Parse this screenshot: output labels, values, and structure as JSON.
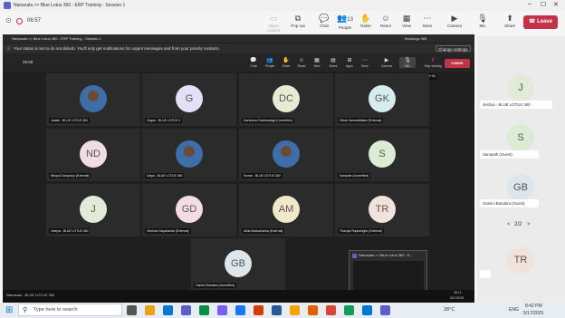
{
  "outer": {
    "title": "Nanasala >> Blue Lotus 360 - ERP Training - Session 1",
    "timer": "06:57",
    "toolbar": [
      {
        "label": "Open context",
        "icon": "context-icon"
      },
      {
        "label": "Pop out",
        "icon": "popout-icon"
      },
      {
        "label": "Chat",
        "icon": "chat-icon"
      },
      {
        "label": "People",
        "icon": "people-icon",
        "count": "13"
      },
      {
        "label": "Raise",
        "icon": "raise-hand-icon"
      },
      {
        "label": "React",
        "icon": "react-icon"
      },
      {
        "label": "View",
        "icon": "view-icon"
      },
      {
        "label": "More",
        "icon": "more-icon"
      },
      {
        "label": "Camera",
        "icon": "camera-icon"
      },
      {
        "label": "Mic",
        "icon": "mic-icon"
      },
      {
        "label": "Share",
        "icon": "share-icon"
      }
    ],
    "leave_label": "Leave"
  },
  "side_panel": {
    "participants": [
      {
        "initials": "J",
        "name": "Jeshya - BLUE LOTUS 360"
      },
      {
        "initials": "S",
        "name": "Sampath (Guest)"
      },
      {
        "initials": "GB",
        "name": "Gamini Bandara (Guest)"
      },
      {
        "initials": "TR",
        "name": ""
      }
    ],
    "pager": "2/2"
  },
  "inner": {
    "title": "Nanasala >> Blue Lotus 360 - ERP Training - Session 1",
    "bookings": "Bookings 365",
    "notice": "Your status is set to do not disturb. You'll only get notifications for urgent messages and from your priority contacts.",
    "change_settings": "Change settings",
    "timer": "39:59",
    "toolbar": [
      {
        "label": "Chat",
        "icon": "chat-icon"
      },
      {
        "label": "People",
        "icon": "people-icon",
        "count": "13"
      },
      {
        "label": "Raise",
        "icon": "raise-hand-icon"
      },
      {
        "label": "React",
        "icon": "react-icon"
      },
      {
        "label": "View",
        "icon": "view-icon"
      },
      {
        "label": "Notes",
        "icon": "notes-icon"
      },
      {
        "label": "Apps",
        "icon": "apps-icon"
      },
      {
        "label": "More",
        "icon": "more-icon"
      },
      {
        "label": "Camera",
        "icon": "camera-icon"
      },
      {
        "label": "Mic",
        "icon": "mic-icon"
      },
      {
        "label": "Stop sharing",
        "icon": "stop-share-icon"
      }
    ],
    "mic_tooltip": "Mute mic (Ctrl+Shift+M)",
    "leave_label": "Leave",
    "tiles": [
      {
        "initials": "",
        "photo": true,
        "name": "Janani - BLUE LOTUS 360",
        "bg": "#3a3a3a"
      },
      {
        "initials": "G",
        "name": "Gayan - BLUE LOTUS 3",
        "bg": "#e3e0f5"
      },
      {
        "initials": "DC",
        "name": "Darshana Chathuranga (Unverified)",
        "bg": "#e9ead3"
      },
      {
        "initials": "GK",
        "name": "Gihan Karunathilake (External)",
        "bg": "#d6ecef"
      },
      {
        "initials": "ND",
        "name": "Nilupul Danupriya (External)",
        "bg": "#f3dde4"
      },
      {
        "initials": "",
        "photo": true,
        "name": "Dayal - BLUE LOTUS 360",
        "bg": "#3a3a3a"
      },
      {
        "initials": "",
        "photo": true,
        "name": "Kumar - BLUE LOTUS 360",
        "bg": "#3a3a3a"
      },
      {
        "initials": "S",
        "name": "Sampath (Unverified)",
        "bg": "#dbebd4"
      },
      {
        "initials": "J",
        "name": "Jeshya - BLUE LOTUS 360",
        "bg": "#e2ebd8"
      },
      {
        "initials": "GD",
        "name": "Gimhani Dayananda (External)",
        "bg": "#f3dde2"
      },
      {
        "initials": "AM",
        "name": "Akila Madushanka (External)",
        "bg": "#f1e8c9"
      },
      {
        "initials": "TR",
        "name": "Thanuja Rupasinghe (External)",
        "bg": "#f2e2dc"
      },
      {
        "initials": "GB",
        "name": "Gamini Bandara (Unverified)",
        "bg": "#dde6ea"
      }
    ],
    "preview_title": "Nanasala >> Blue Lotus 360 - E...",
    "taskbar_time": "08:12",
    "taskbar_date": "5/17/2025",
    "taskbar_label": "Nanasala - BLUE LOTUS 360"
  },
  "taskbar": {
    "search_placeholder": "Type here to search",
    "weather": "28°C",
    "lang": "ENG",
    "time": "8:42 PM",
    "date": "5/17/2025"
  }
}
